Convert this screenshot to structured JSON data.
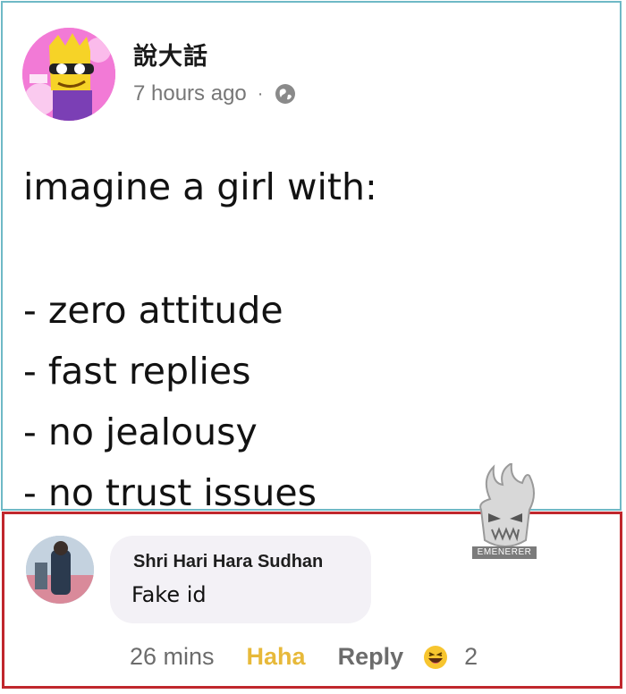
{
  "post": {
    "author": "說大話",
    "time": "7 hours ago",
    "separator": "·",
    "privacy_icon": "globe-icon",
    "lines": [
      "imagine a girl with:",
      "- zero attitude",
      "- fast replies",
      "- no jealousy",
      "- no trust issues"
    ]
  },
  "watermark": {
    "label": "EMENERER"
  },
  "comment": {
    "author": "Shri Hari Hara Sudhan",
    "text": "Fake id",
    "time": "26 mins",
    "reaction_label": "Haha",
    "reply_label": "Reply",
    "reaction_icon": "laughing-emoji-icon",
    "reaction_count": "2"
  },
  "colors": {
    "post_border": "#6fb9c6",
    "comment_border": "#c0272d",
    "haha": "#e7b93a",
    "bubble": "#f3f1f6"
  }
}
